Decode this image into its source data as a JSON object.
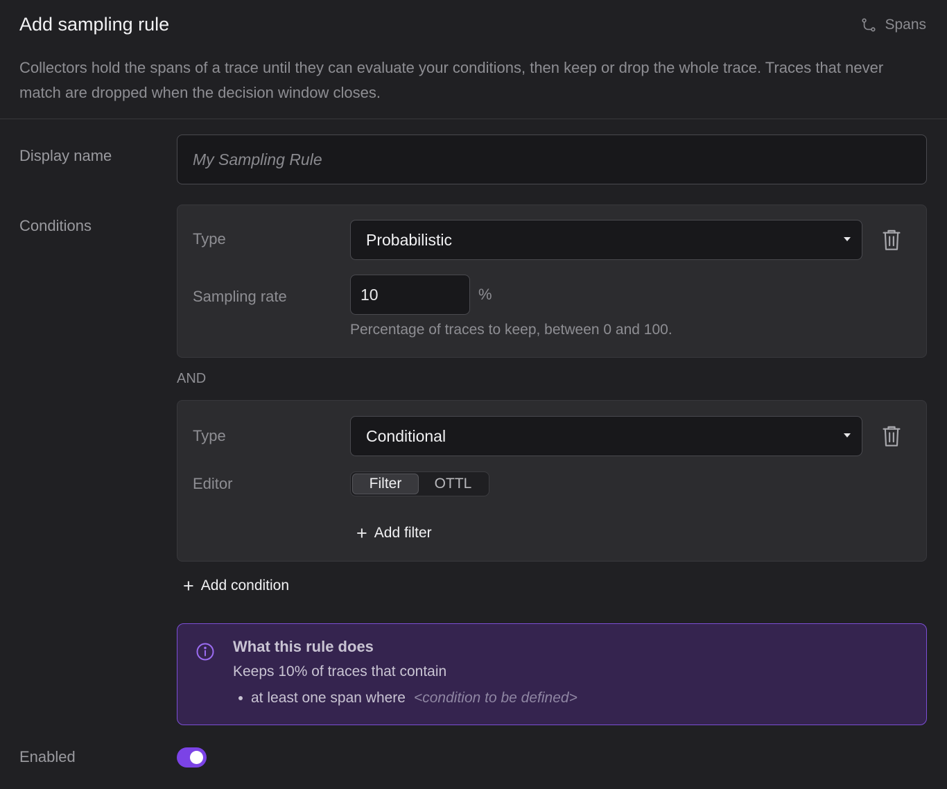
{
  "header": {
    "title": "Add sampling rule",
    "link_label": "Spans",
    "link_icon": "branch-icon",
    "description": "Collectors hold the spans of a trace until they can evaluate your conditions, then keep or drop the whole trace. Traces that never match are dropped when the decision window closes."
  },
  "display_name": {
    "label": "Display name",
    "placeholder": "My Sampling Rule",
    "value": ""
  },
  "conditions": {
    "label": "Conditions",
    "items": [
      {
        "type_label": "Type",
        "type_value": "Probabilistic",
        "rate_label": "Sampling rate",
        "rate_value": "10",
        "rate_unit": "%",
        "hint": "Percentage of traces to keep, between 0 and 100."
      },
      {
        "type_label": "Type",
        "type_value": "Conditional",
        "editor_label": "Editor",
        "editor_options": [
          "Filter",
          "OTTL"
        ],
        "editor_selected": "Filter",
        "add_filter_label": "Add filter"
      }
    ],
    "joiner": "AND",
    "add_condition_label": "Add condition"
  },
  "info": {
    "title": "What this rule does",
    "body": "Keeps 10% of traces that contain",
    "bullet_text": "at least one span where",
    "bullet_placeholder": "<condition to be defined>"
  },
  "enabled": {
    "label": "Enabled",
    "value": true
  },
  "colors": {
    "background": "#202023",
    "accent": "#7b43e6",
    "info_bg": "#35244f",
    "info_border": "#7c4fd6"
  }
}
